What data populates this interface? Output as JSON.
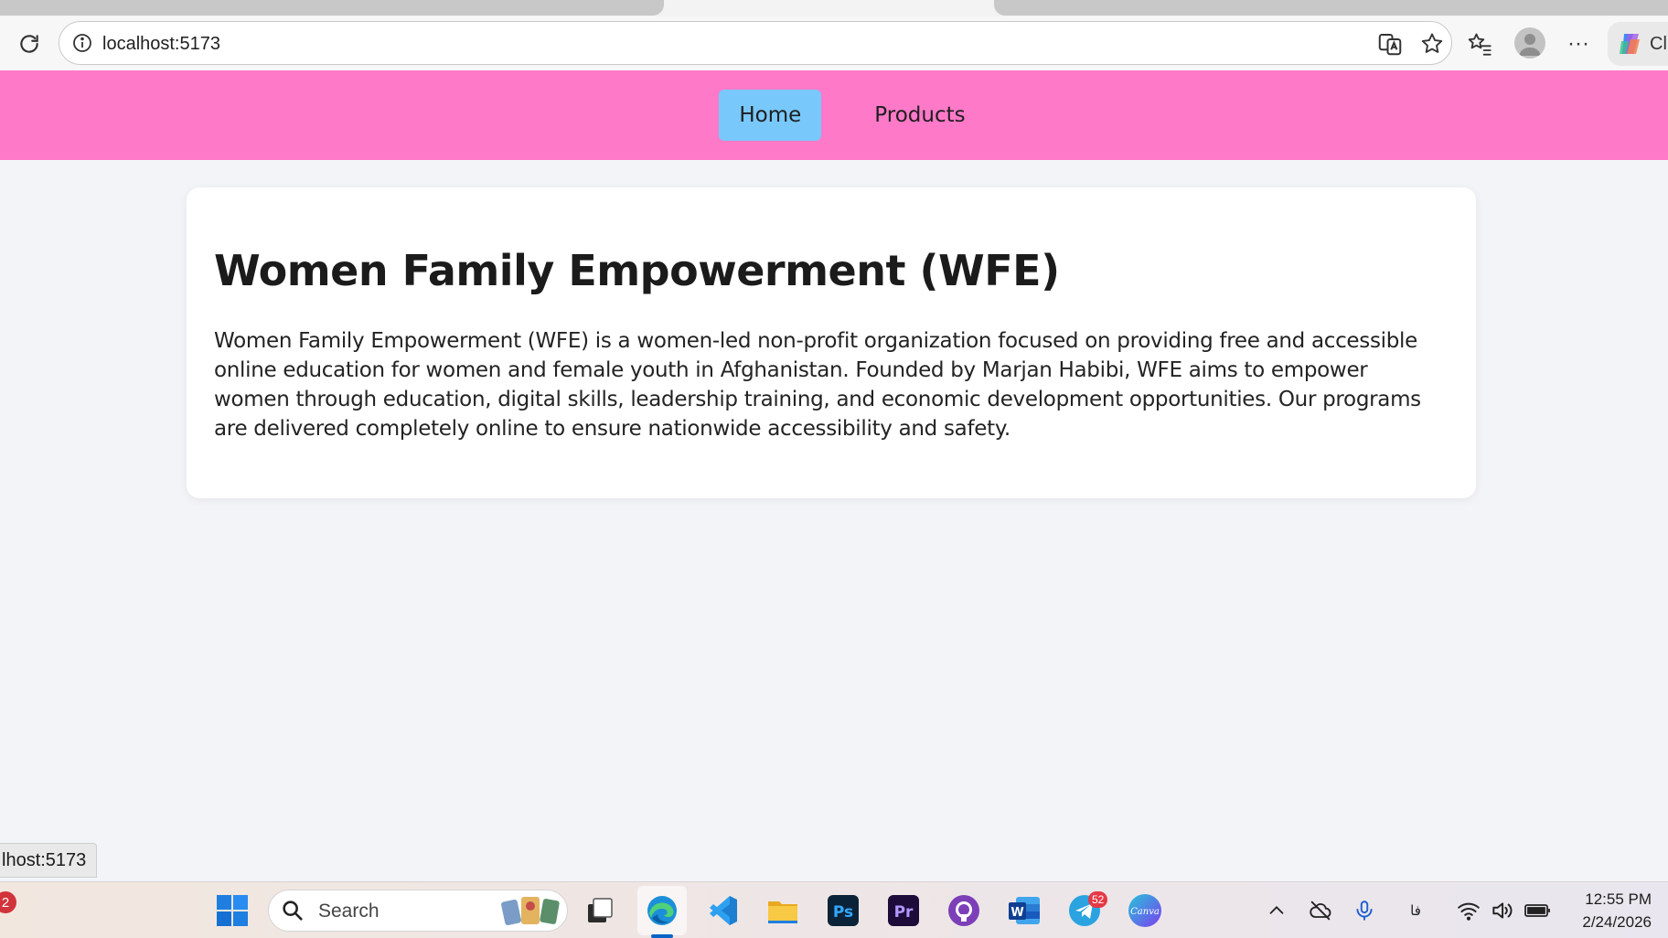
{
  "browser": {
    "url": "localhost:5173",
    "copilot_label": "Cl",
    "more_glyph": "···"
  },
  "nav": {
    "items": [
      {
        "label": "Home",
        "active": true
      },
      {
        "label": "Products",
        "active": false
      }
    ]
  },
  "main": {
    "title": "Women Family Empowerment (WFE)",
    "description": "Women Family Empowerment (WFE) is a women-led non-profit organization focused on providing free and accessible online education for women and female youth in Afghanistan. Founded by Marjan Habibi, WFE aims to empower women through education, digital skills, leadership training, and economic development opportunities. Our programs are delivered completely online to ensure nationwide accessibility and safety."
  },
  "status_bar": {
    "hover_url": "lhost:5173"
  },
  "taskbar": {
    "notification_count": "2",
    "search_label": "Search",
    "telegram_badge": "52",
    "canva_label": "Canva",
    "ps_label": "Ps",
    "pr_label": "Pr",
    "word_label": "W",
    "language_indicator": "فا",
    "time": "12:55 PM",
    "date": "2/24/2026"
  },
  "colors": {
    "nav_bg": "#ff79c9",
    "nav_active": "#78c8fb",
    "page_bg": "#f3f4f8",
    "card_bg": "#ffffff"
  }
}
